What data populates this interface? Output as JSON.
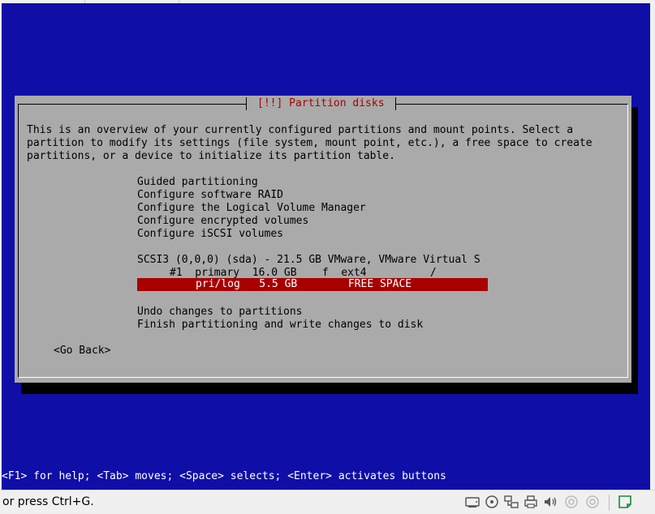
{
  "dialog": {
    "title": "[!!] Partition disks",
    "description": [
      "This is an overview of your currently configured partitions and mount points. Select a",
      "partition to modify its settings (file system, mount point, etc.), a free space to create",
      "partitions, or a device to initialize its partition table."
    ],
    "menu": [
      "Guided partitioning",
      "Configure software RAID",
      "Configure the Logical Volume Manager",
      "Configure encrypted volumes",
      "Configure iSCSI volumes"
    ],
    "disk": "SCSI3 (0,0,0) (sda) - 21.5 GB VMware, VMware Virtual S",
    "partition1": "#1  primary  16.0 GB    f  ext4          /",
    "free_space": "pri/log   5.5 GB        FREE SPACE",
    "actions": [
      "Undo changes to partitions",
      "Finish partitioning and write changes to disk"
    ],
    "go_back": "<Go Back>"
  },
  "status_bar": "<F1> for help; <Tab> moves; <Space> selects; <Enter> activates buttons",
  "host": {
    "hint": "or press Ctrl+G.",
    "icons": [
      "hard-disk-icon",
      "optical-drive-icon",
      "network-icon",
      "printer-icon",
      "sound-icon",
      "usb-icon",
      "record-icon",
      "notes-icon"
    ]
  }
}
